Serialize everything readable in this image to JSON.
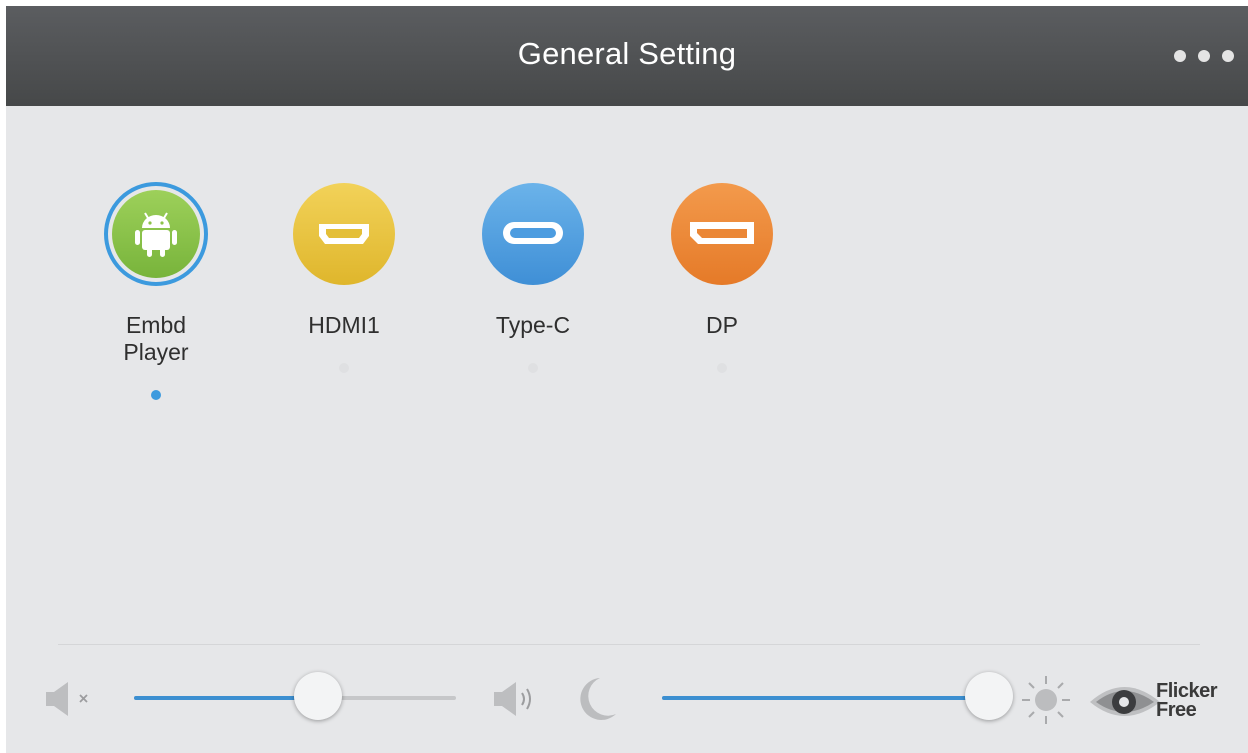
{
  "header": {
    "title": "General Setting",
    "more_icon": "more-horizontal-icon"
  },
  "sources": [
    {
      "label": "Embd Player",
      "icon": "android-icon",
      "color": "#8cc34a",
      "selected": true
    },
    {
      "label": "HDMI1",
      "icon": "hdmi-port-icon",
      "color": "#e9c63e",
      "selected": false
    },
    {
      "label": "Type-C",
      "icon": "usb-type-c-icon",
      "color": "#4f9ee0",
      "selected": false
    },
    {
      "label": "DP",
      "icon": "displayport-icon",
      "color": "#ec8a3a",
      "selected": false
    }
  ],
  "controls": {
    "volume": {
      "min_icon": "speaker-mute-icon",
      "max_icon": "speaker-loud-icon",
      "value_fraction": 0.57
    },
    "brightness": {
      "min_icon": "moon-icon",
      "max_icon": "sun-icon",
      "value_fraction": 0.99
    },
    "flicker_free": {
      "line1": "Flicker",
      "line2": "Free",
      "icon": "eye-icon"
    }
  },
  "colors": {
    "accent": "#3c8fd1",
    "titlebar": "#505254",
    "background": "#e6e7e9"
  }
}
